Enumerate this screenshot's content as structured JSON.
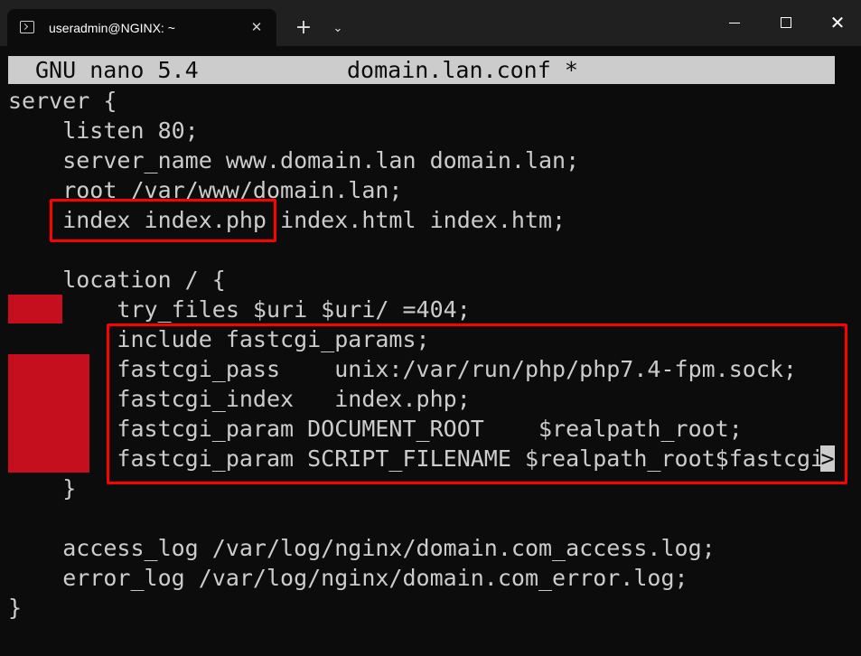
{
  "window": {
    "tab_title": "useradmin@NGINX: ~",
    "tab_close": "✕",
    "new_tab": "+",
    "dropdown": "⌄",
    "close": "✕"
  },
  "nano": {
    "app": "GNU nano 5.4",
    "filename": "domain.lan.conf *"
  },
  "editor": {
    "lines": {
      "l1": "server {",
      "l2": "    listen 80;",
      "l3": "    server_name www.domain.lan domain.lan;",
      "l4": "    root /var/www/domain.lan;",
      "l5": "    index index.php index.html index.htm;",
      "l7": "    location / {",
      "l8": "        try_files $uri $uri/ =404;",
      "l9": "        include fastcgi_params;",
      "l10": "        fastcgi_pass    unix:/var/run/php/php7.4-fpm.sock;",
      "l11": "        fastcgi_index   index.php;",
      "l12": "        fastcgi_param DOCUMENT_ROOT    $realpath_root;",
      "l13": "        fastcgi_param SCRIPT_FILENAME $realpath_root$fastcgi",
      "l14": "    }",
      "l16": "    access_log /var/log/nginx/domain.com_access.log;",
      "l17": "    error_log /var/log/nginx/domain.com_error.log;",
      "l18": "}"
    },
    "overflow_marker": ">"
  },
  "colors": {
    "terminal_bg": "#0c0c0c",
    "text": "#cccccc",
    "highlight_box": "#ff0000",
    "diff_marker": "#c50f1f"
  }
}
